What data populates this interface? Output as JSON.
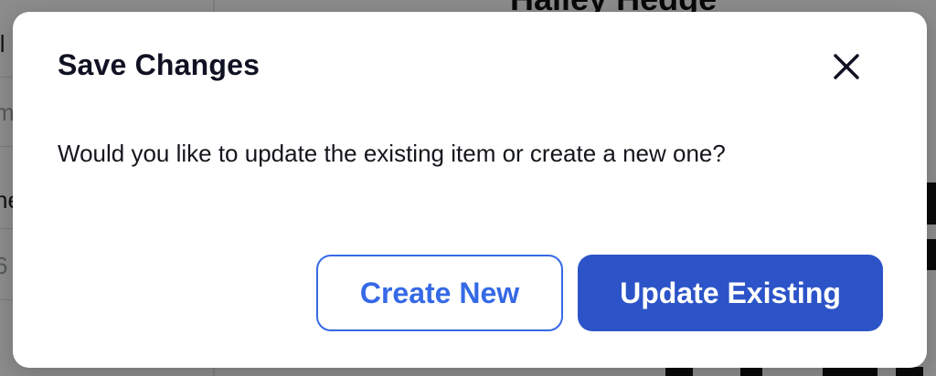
{
  "background": {
    "left_cells": [
      "il",
      "m",
      "ne",
      "6"
    ],
    "profile_name": "Hailey Hedge"
  },
  "modal": {
    "title": "Save Changes",
    "message": "Would you like to update the existing item or create a new one?",
    "close_icon": "close-icon",
    "buttons": {
      "create_new": "Create New",
      "update_existing": "Update Existing"
    }
  },
  "colors": {
    "primary": "#2c54c8",
    "secondary_text": "#3569e6",
    "title": "#101223"
  }
}
